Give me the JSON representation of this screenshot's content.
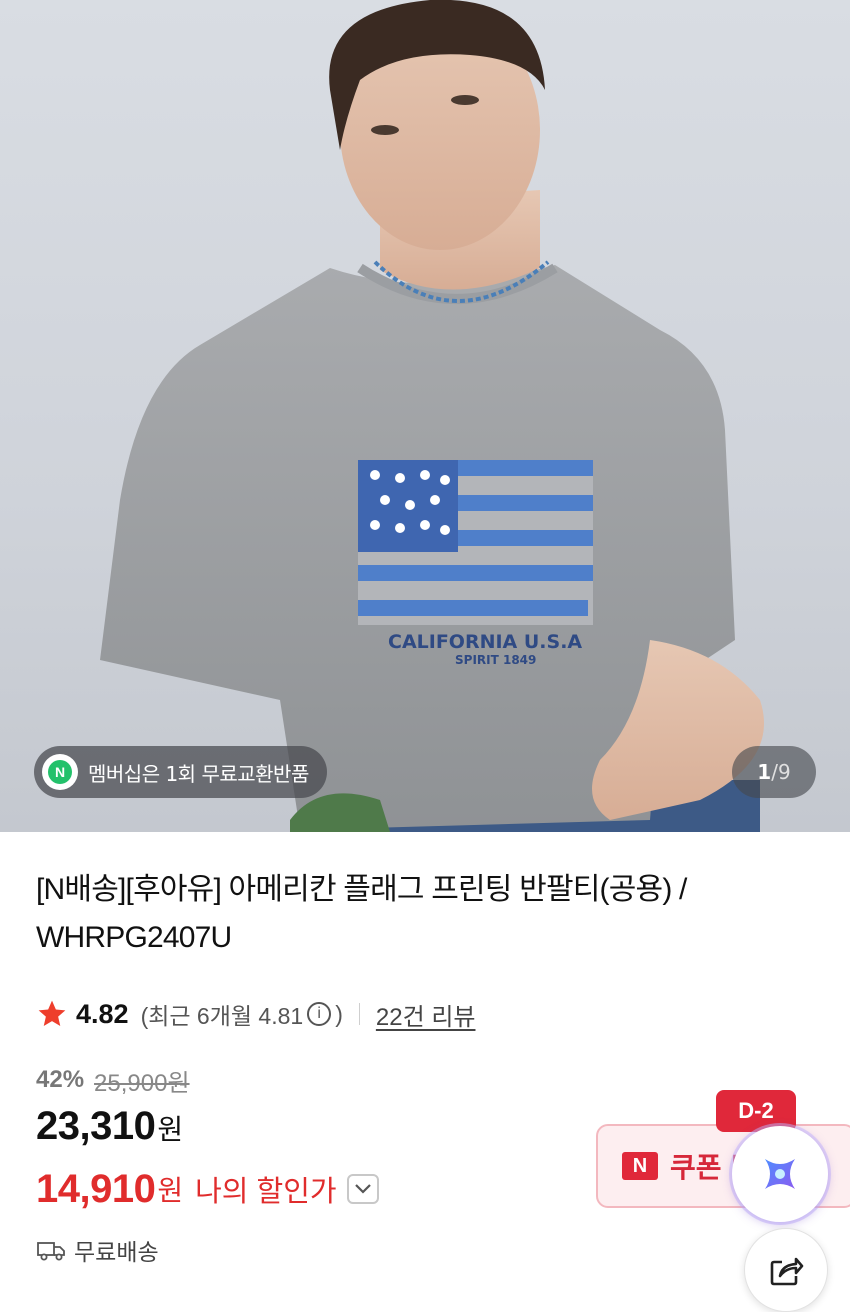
{
  "gallery": {
    "membership_badge_letter": "N",
    "membership_text": "멤버십은 1회 무료교환반품",
    "current_page": "1",
    "separator": "/",
    "total_pages": "9",
    "print_text_1": "CALIFORNIA U.S.A",
    "print_text_2": "SPIRIT 1849"
  },
  "product": {
    "title": "[N배송][후아유] 아메리칸 플래그 프린팅 반팔티(공용) / WHRPG2407U",
    "rating": "4.82",
    "recent_rating_prefix": "(최근 6개월 4.81",
    "recent_rating_suffix": ")",
    "info_icon_glyph": "i",
    "review_link": "22건 리뷰",
    "discount_percent": "42%",
    "original_price": "25,900원",
    "price": "23,310",
    "price_unit": "원",
    "my_price": "14,910",
    "my_price_unit": "원",
    "my_price_label": "나의 할인가",
    "shipping": "무료배송"
  },
  "coupon": {
    "dday": "D-2",
    "logo_letter": "N",
    "label": "쿠폰 받기"
  },
  "colors": {
    "accent_red": "#e02c2c",
    "coupon_red": "#e0283a",
    "membership_green": "#23c16b"
  },
  "icons": {
    "rating": "star-icon",
    "shipping": "truck-icon",
    "dropdown": "chevron-down-icon",
    "ai": "ai-sparkle-icon",
    "share": "share-icon"
  }
}
